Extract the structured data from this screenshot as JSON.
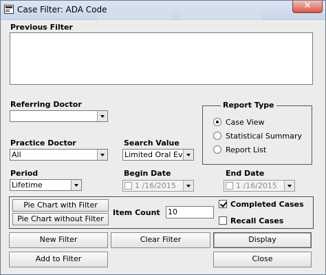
{
  "window": {
    "title": "Case Filter: ADA Code",
    "close_glyph": "✕"
  },
  "previous_filter": {
    "label": "Previous Filter",
    "value": ""
  },
  "referring_doctor": {
    "label": "Referring Doctor",
    "value": ""
  },
  "practice_doctor": {
    "label": "Practice Doctor",
    "value": "All"
  },
  "search_value": {
    "label": "Search Value",
    "value": "Limited Oral Ev"
  },
  "period": {
    "label": "Period",
    "value": "Lifetime"
  },
  "begin_date": {
    "label": "Begin Date",
    "value": "1 /16/2015"
  },
  "end_date": {
    "label": "End Date",
    "value": "1 /16/2015"
  },
  "report_type": {
    "label": "Report Type",
    "options": [
      "Case View",
      "Statistical Summary",
      "Report List"
    ],
    "selected": "Case View"
  },
  "charts": {
    "with_filter": "Pie Chart with Filter",
    "without_filter": "Pie Chart without Filter"
  },
  "item_count": {
    "label": "Item Count",
    "value": "10"
  },
  "completed_cases": {
    "label": "Completed Cases",
    "checked": true
  },
  "recall_cases": {
    "label": "Recall Cases",
    "checked": false
  },
  "buttons": {
    "new_filter": "New Filter",
    "clear_filter": "Clear Filter",
    "display": "Display",
    "add_to_filter": "Add to Filter",
    "close": "Close"
  }
}
